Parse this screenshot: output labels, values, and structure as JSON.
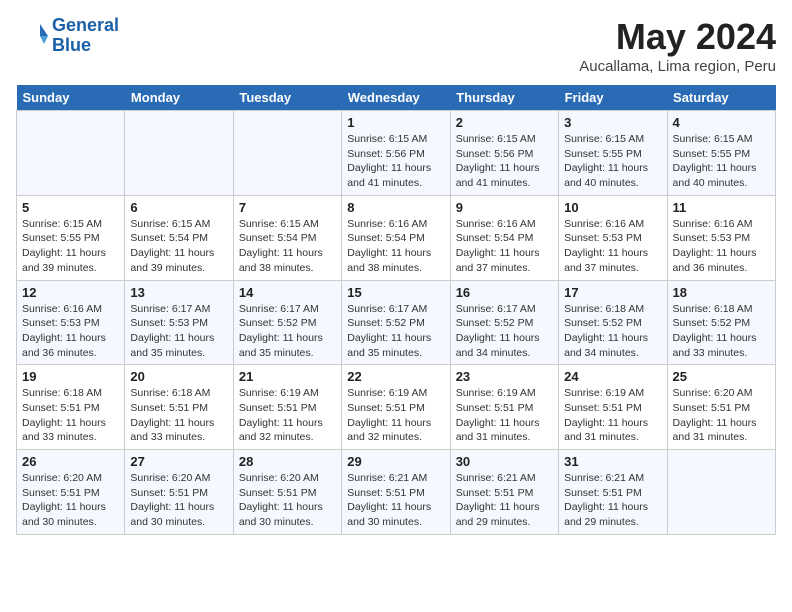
{
  "header": {
    "logo_line1": "General",
    "logo_line2": "Blue",
    "month_year": "May 2024",
    "location": "Aucallama, Lima region, Peru"
  },
  "weekdays": [
    "Sunday",
    "Monday",
    "Tuesday",
    "Wednesday",
    "Thursday",
    "Friday",
    "Saturday"
  ],
  "weeks": [
    [
      {
        "day": "",
        "info": ""
      },
      {
        "day": "",
        "info": ""
      },
      {
        "day": "",
        "info": ""
      },
      {
        "day": "1",
        "info": "Sunrise: 6:15 AM\nSunset: 5:56 PM\nDaylight: 11 hours\nand 41 minutes."
      },
      {
        "day": "2",
        "info": "Sunrise: 6:15 AM\nSunset: 5:56 PM\nDaylight: 11 hours\nand 41 minutes."
      },
      {
        "day": "3",
        "info": "Sunrise: 6:15 AM\nSunset: 5:55 PM\nDaylight: 11 hours\nand 40 minutes."
      },
      {
        "day": "4",
        "info": "Sunrise: 6:15 AM\nSunset: 5:55 PM\nDaylight: 11 hours\nand 40 minutes."
      }
    ],
    [
      {
        "day": "5",
        "info": "Sunrise: 6:15 AM\nSunset: 5:55 PM\nDaylight: 11 hours\nand 39 minutes."
      },
      {
        "day": "6",
        "info": "Sunrise: 6:15 AM\nSunset: 5:54 PM\nDaylight: 11 hours\nand 39 minutes."
      },
      {
        "day": "7",
        "info": "Sunrise: 6:15 AM\nSunset: 5:54 PM\nDaylight: 11 hours\nand 38 minutes."
      },
      {
        "day": "8",
        "info": "Sunrise: 6:16 AM\nSunset: 5:54 PM\nDaylight: 11 hours\nand 38 minutes."
      },
      {
        "day": "9",
        "info": "Sunrise: 6:16 AM\nSunset: 5:54 PM\nDaylight: 11 hours\nand 37 minutes."
      },
      {
        "day": "10",
        "info": "Sunrise: 6:16 AM\nSunset: 5:53 PM\nDaylight: 11 hours\nand 37 minutes."
      },
      {
        "day": "11",
        "info": "Sunrise: 6:16 AM\nSunset: 5:53 PM\nDaylight: 11 hours\nand 36 minutes."
      }
    ],
    [
      {
        "day": "12",
        "info": "Sunrise: 6:16 AM\nSunset: 5:53 PM\nDaylight: 11 hours\nand 36 minutes."
      },
      {
        "day": "13",
        "info": "Sunrise: 6:17 AM\nSunset: 5:53 PM\nDaylight: 11 hours\nand 35 minutes."
      },
      {
        "day": "14",
        "info": "Sunrise: 6:17 AM\nSunset: 5:52 PM\nDaylight: 11 hours\nand 35 minutes."
      },
      {
        "day": "15",
        "info": "Sunrise: 6:17 AM\nSunset: 5:52 PM\nDaylight: 11 hours\nand 35 minutes."
      },
      {
        "day": "16",
        "info": "Sunrise: 6:17 AM\nSunset: 5:52 PM\nDaylight: 11 hours\nand 34 minutes."
      },
      {
        "day": "17",
        "info": "Sunrise: 6:18 AM\nSunset: 5:52 PM\nDaylight: 11 hours\nand 34 minutes."
      },
      {
        "day": "18",
        "info": "Sunrise: 6:18 AM\nSunset: 5:52 PM\nDaylight: 11 hours\nand 33 minutes."
      }
    ],
    [
      {
        "day": "19",
        "info": "Sunrise: 6:18 AM\nSunset: 5:51 PM\nDaylight: 11 hours\nand 33 minutes."
      },
      {
        "day": "20",
        "info": "Sunrise: 6:18 AM\nSunset: 5:51 PM\nDaylight: 11 hours\nand 33 minutes."
      },
      {
        "day": "21",
        "info": "Sunrise: 6:19 AM\nSunset: 5:51 PM\nDaylight: 11 hours\nand 32 minutes."
      },
      {
        "day": "22",
        "info": "Sunrise: 6:19 AM\nSunset: 5:51 PM\nDaylight: 11 hours\nand 32 minutes."
      },
      {
        "day": "23",
        "info": "Sunrise: 6:19 AM\nSunset: 5:51 PM\nDaylight: 11 hours\nand 31 minutes."
      },
      {
        "day": "24",
        "info": "Sunrise: 6:19 AM\nSunset: 5:51 PM\nDaylight: 11 hours\nand 31 minutes."
      },
      {
        "day": "25",
        "info": "Sunrise: 6:20 AM\nSunset: 5:51 PM\nDaylight: 11 hours\nand 31 minutes."
      }
    ],
    [
      {
        "day": "26",
        "info": "Sunrise: 6:20 AM\nSunset: 5:51 PM\nDaylight: 11 hours\nand 30 minutes."
      },
      {
        "day": "27",
        "info": "Sunrise: 6:20 AM\nSunset: 5:51 PM\nDaylight: 11 hours\nand 30 minutes."
      },
      {
        "day": "28",
        "info": "Sunrise: 6:20 AM\nSunset: 5:51 PM\nDaylight: 11 hours\nand 30 minutes."
      },
      {
        "day": "29",
        "info": "Sunrise: 6:21 AM\nSunset: 5:51 PM\nDaylight: 11 hours\nand 30 minutes."
      },
      {
        "day": "30",
        "info": "Sunrise: 6:21 AM\nSunset: 5:51 PM\nDaylight: 11 hours\nand 29 minutes."
      },
      {
        "day": "31",
        "info": "Sunrise: 6:21 AM\nSunset: 5:51 PM\nDaylight: 11 hours\nand 29 minutes."
      },
      {
        "day": "",
        "info": ""
      }
    ]
  ]
}
